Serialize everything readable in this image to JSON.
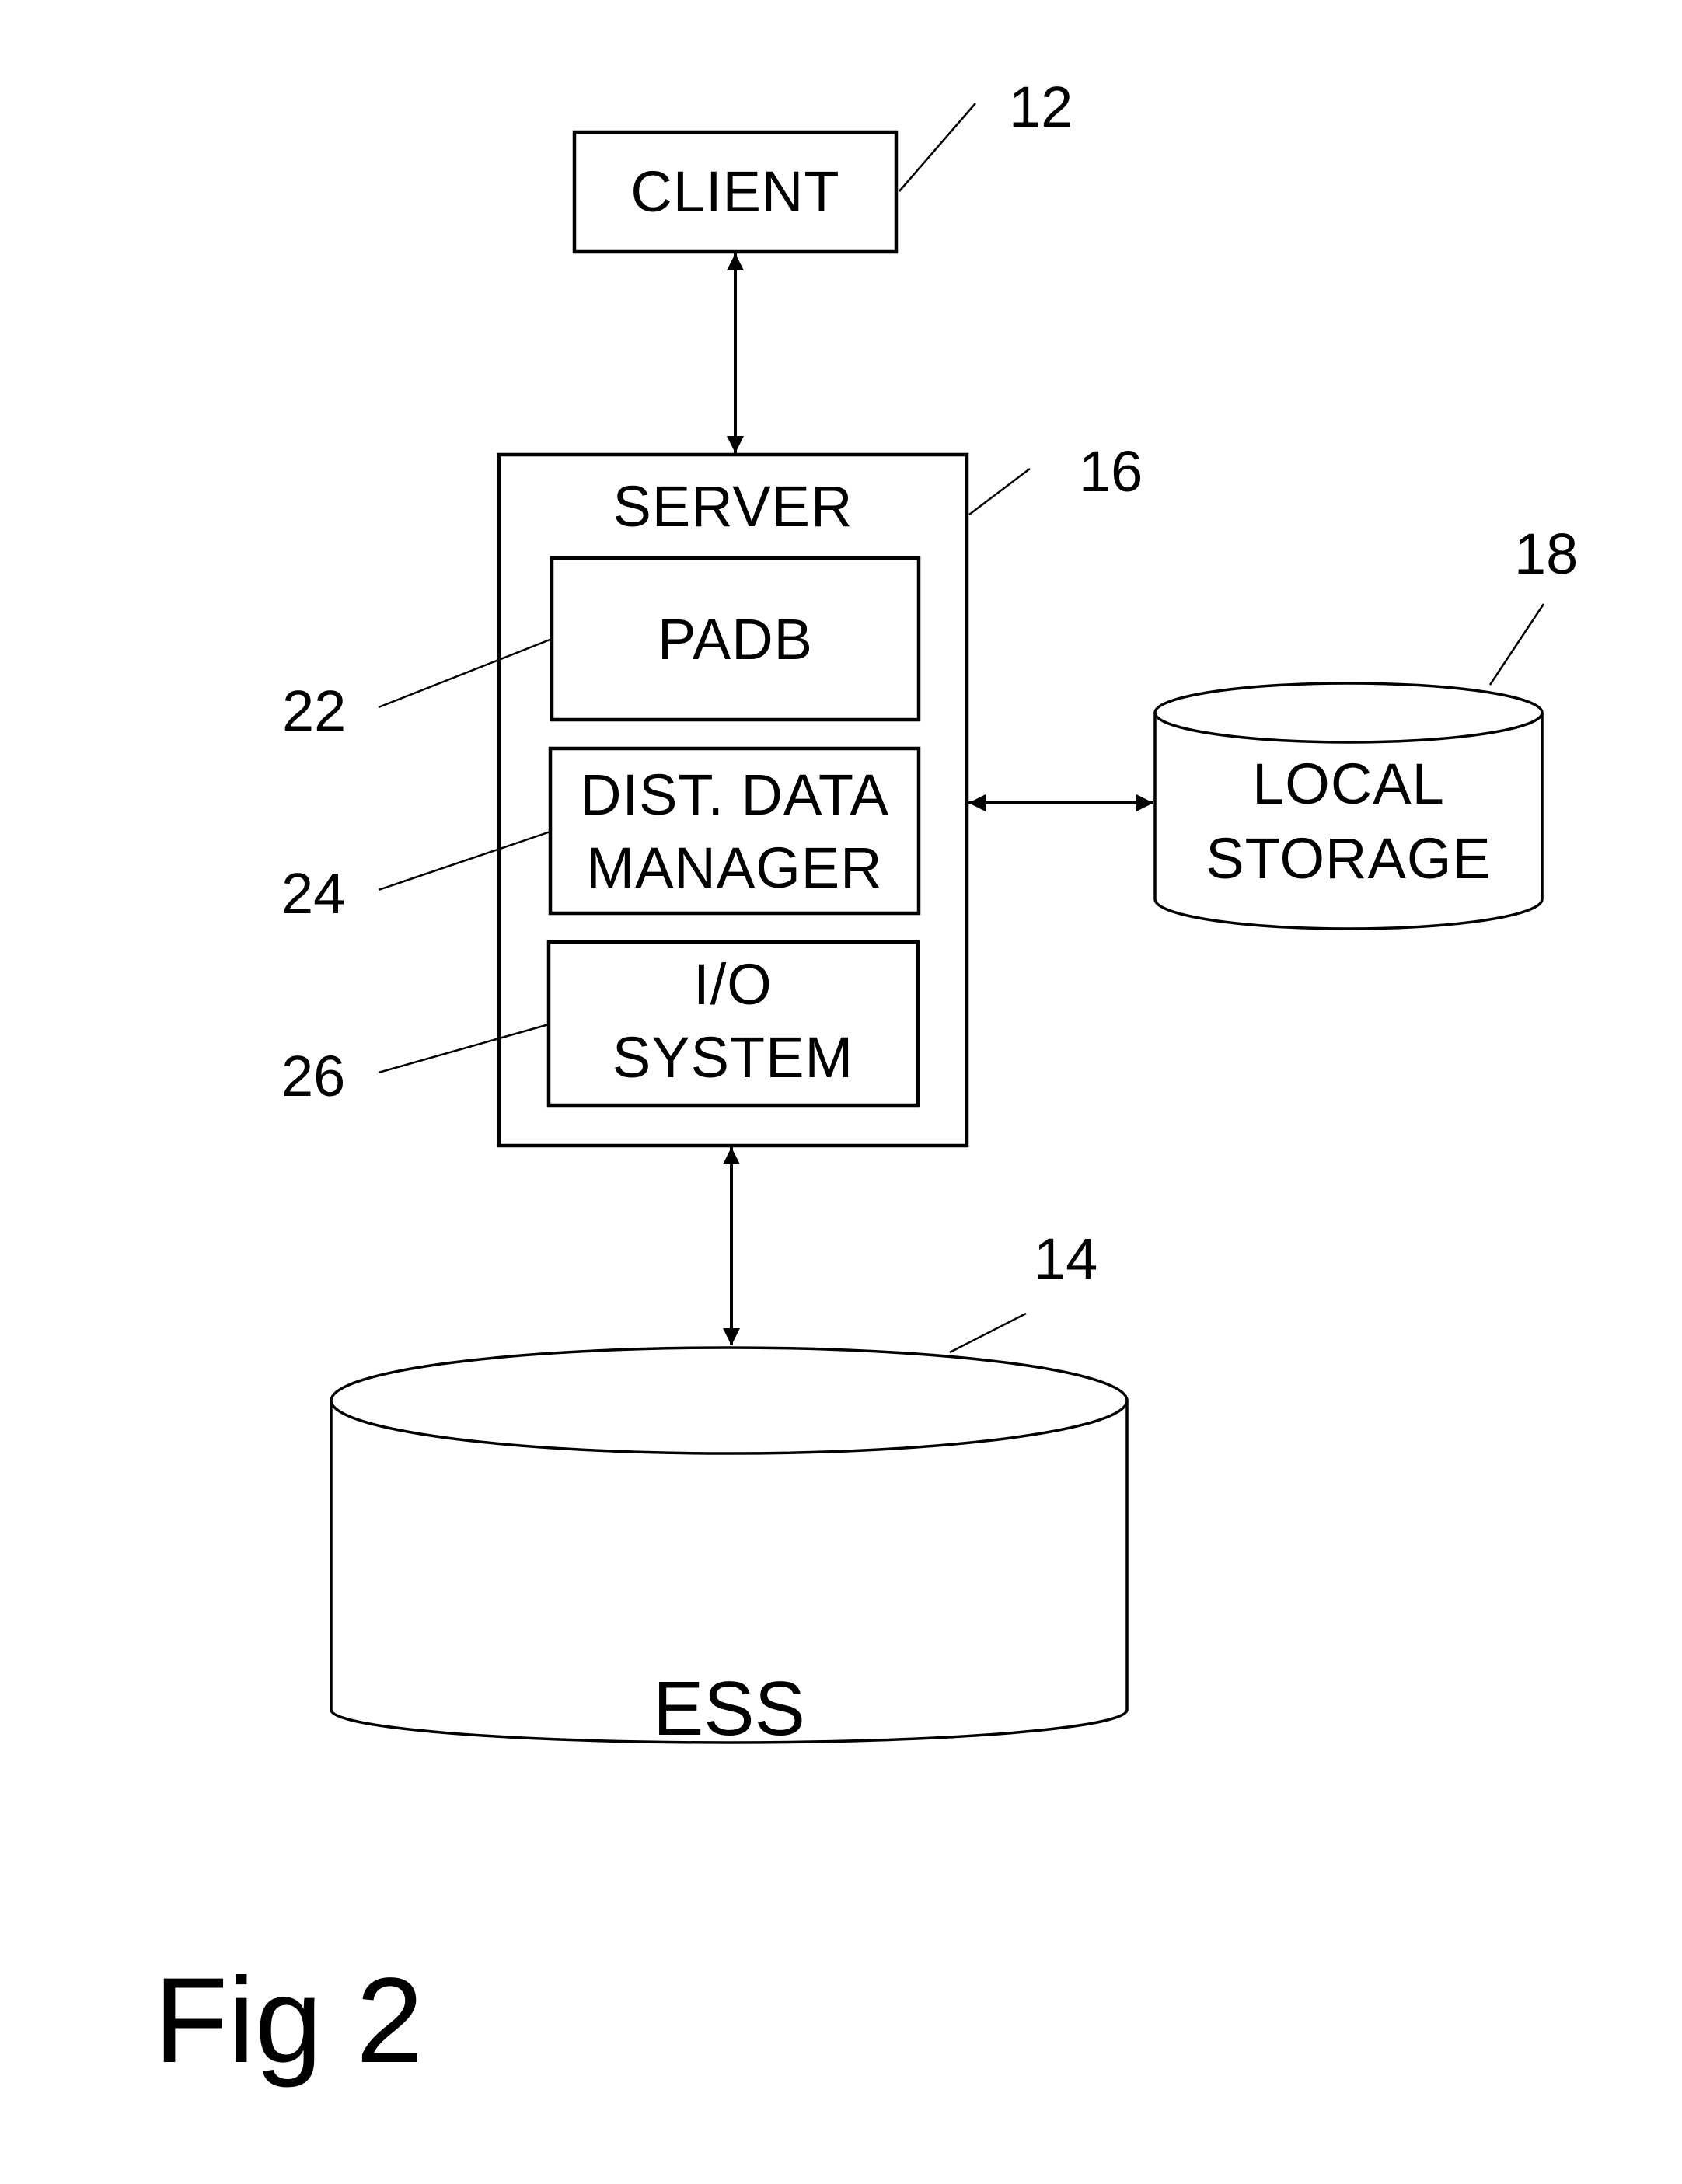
{
  "figure": {
    "caption": "Fig 2"
  },
  "nodes": {
    "client": {
      "label": "CLIENT",
      "ref": "12"
    },
    "server": {
      "label": "SERVER",
      "ref": "16",
      "components": [
        {
          "id": "padb",
          "lines": [
            "PADB"
          ],
          "ref": "22"
        },
        {
          "id": "dist-data-manager",
          "lines": [
            "DIST. DATA",
            "MANAGER"
          ],
          "ref": "24"
        },
        {
          "id": "io-system",
          "lines": [
            "I/O",
            "SYSTEM"
          ],
          "ref": "26"
        }
      ]
    },
    "local_storage": {
      "lines": [
        "LOCAL",
        "STORAGE"
      ],
      "ref": "18"
    },
    "ess": {
      "label": "ESS",
      "ref": "14"
    }
  },
  "connections": [
    {
      "from": "client",
      "to": "server",
      "type": "bidirectional"
    },
    {
      "from": "server",
      "to": "local_storage",
      "type": "bidirectional"
    },
    {
      "from": "server",
      "to": "ess",
      "type": "bidirectional"
    }
  ]
}
